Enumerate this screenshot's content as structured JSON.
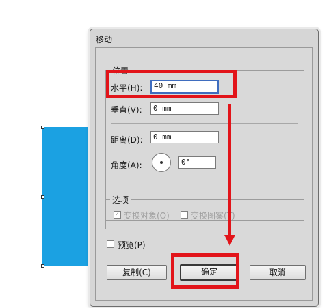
{
  "dialog": {
    "title": "移动",
    "position_group": {
      "legend": "位置",
      "horizontal_label": "水平(H):",
      "horizontal_value": "40 mm",
      "vertical_label": "垂直(V):",
      "vertical_value": "0 mm",
      "distance_label": "距离(D):",
      "distance_value": "0 mm",
      "angle_label": "角度(A):",
      "angle_value": "0°"
    },
    "options_group": {
      "legend": "选项",
      "transform_objects_label": "变换对象(O)",
      "transform_objects_checked": true,
      "transform_patterns_label": "变换图案(T)",
      "transform_patterns_checked": false
    },
    "preview_label": "预览(P)",
    "preview_checked": false,
    "buttons": {
      "copy": "复制(C)",
      "ok": "确定",
      "cancel": "取消"
    }
  },
  "colors": {
    "shape_fill": "#1ba1e2",
    "highlight": "#e2141a",
    "dialog_bg": "#d6d6d6"
  }
}
